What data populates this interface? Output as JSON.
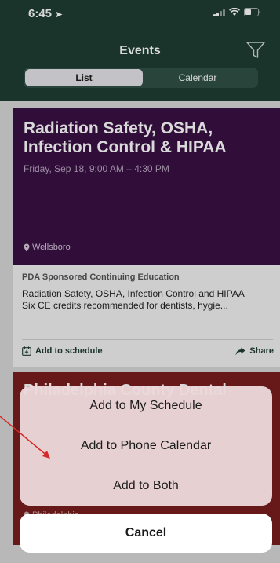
{
  "status_bar": {
    "time": "6:45"
  },
  "header": {
    "title": "Events",
    "segments": [
      "List",
      "Calendar"
    ],
    "selected_segment": "List"
  },
  "event1": {
    "title": "Radiation Safety, OSHA, Infection Control & HIPAA",
    "datetime": "Friday, Sep 18, 9:00 AM – 4:30 PM",
    "location": "Wellsboro",
    "sponsor": "PDA Sponsored Continuing Education",
    "description_line1": "Radiation Safety, OSHA, Infection Control and HIPAA",
    "description_line2": "Six CE credits recommended for dentists, hygie...",
    "add_label": "Add to schedule",
    "share_label": "Share",
    "hero_color": "#3a1145"
  },
  "event2": {
    "title": "Philadelphia County Dental",
    "location": "Philadelphia",
    "hero_color": "#7a1d1d"
  },
  "action_sheet": {
    "options": [
      "Add to My Schedule",
      "Add to Phone Calendar",
      "Add to Both"
    ],
    "cancel": "Cancel"
  },
  "theme": {
    "header_color": "#1f3d33",
    "annotation_color": "#d62a2a"
  }
}
